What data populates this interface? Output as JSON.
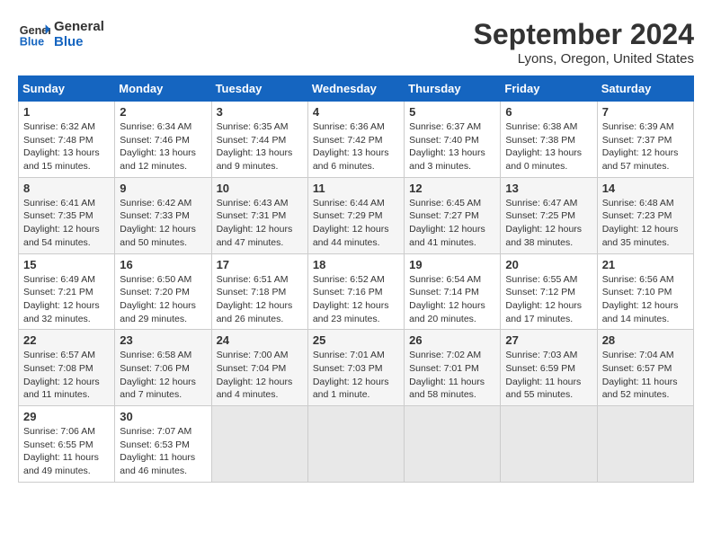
{
  "header": {
    "logo_line1": "General",
    "logo_line2": "Blue",
    "title": "September 2024",
    "subtitle": "Lyons, Oregon, United States"
  },
  "days_of_week": [
    "Sunday",
    "Monday",
    "Tuesday",
    "Wednesday",
    "Thursday",
    "Friday",
    "Saturday"
  ],
  "weeks": [
    [
      {
        "day": "1",
        "sunrise": "6:32 AM",
        "sunset": "7:48 PM",
        "daylight": "13 hours and 15 minutes."
      },
      {
        "day": "2",
        "sunrise": "6:34 AM",
        "sunset": "7:46 PM",
        "daylight": "13 hours and 12 minutes."
      },
      {
        "day": "3",
        "sunrise": "6:35 AM",
        "sunset": "7:44 PM",
        "daylight": "13 hours and 9 minutes."
      },
      {
        "day": "4",
        "sunrise": "6:36 AM",
        "sunset": "7:42 PM",
        "daylight": "13 hours and 6 minutes."
      },
      {
        "day": "5",
        "sunrise": "6:37 AM",
        "sunset": "7:40 PM",
        "daylight": "13 hours and 3 minutes."
      },
      {
        "day": "6",
        "sunrise": "6:38 AM",
        "sunset": "7:38 PM",
        "daylight": "13 hours and 0 minutes."
      },
      {
        "day": "7",
        "sunrise": "6:39 AM",
        "sunset": "7:37 PM",
        "daylight": "12 hours and 57 minutes."
      }
    ],
    [
      {
        "day": "8",
        "sunrise": "6:41 AM",
        "sunset": "7:35 PM",
        "daylight": "12 hours and 54 minutes."
      },
      {
        "day": "9",
        "sunrise": "6:42 AM",
        "sunset": "7:33 PM",
        "daylight": "12 hours and 50 minutes."
      },
      {
        "day": "10",
        "sunrise": "6:43 AM",
        "sunset": "7:31 PM",
        "daylight": "12 hours and 47 minutes."
      },
      {
        "day": "11",
        "sunrise": "6:44 AM",
        "sunset": "7:29 PM",
        "daylight": "12 hours and 44 minutes."
      },
      {
        "day": "12",
        "sunrise": "6:45 AM",
        "sunset": "7:27 PM",
        "daylight": "12 hours and 41 minutes."
      },
      {
        "day": "13",
        "sunrise": "6:47 AM",
        "sunset": "7:25 PM",
        "daylight": "12 hours and 38 minutes."
      },
      {
        "day": "14",
        "sunrise": "6:48 AM",
        "sunset": "7:23 PM",
        "daylight": "12 hours and 35 minutes."
      }
    ],
    [
      {
        "day": "15",
        "sunrise": "6:49 AM",
        "sunset": "7:21 PM",
        "daylight": "12 hours and 32 minutes."
      },
      {
        "day": "16",
        "sunrise": "6:50 AM",
        "sunset": "7:20 PM",
        "daylight": "12 hours and 29 minutes."
      },
      {
        "day": "17",
        "sunrise": "6:51 AM",
        "sunset": "7:18 PM",
        "daylight": "12 hours and 26 minutes."
      },
      {
        "day": "18",
        "sunrise": "6:52 AM",
        "sunset": "7:16 PM",
        "daylight": "12 hours and 23 minutes."
      },
      {
        "day": "19",
        "sunrise": "6:54 AM",
        "sunset": "7:14 PM",
        "daylight": "12 hours and 20 minutes."
      },
      {
        "day": "20",
        "sunrise": "6:55 AM",
        "sunset": "7:12 PM",
        "daylight": "12 hours and 17 minutes."
      },
      {
        "day": "21",
        "sunrise": "6:56 AM",
        "sunset": "7:10 PM",
        "daylight": "12 hours and 14 minutes."
      }
    ],
    [
      {
        "day": "22",
        "sunrise": "6:57 AM",
        "sunset": "7:08 PM",
        "daylight": "12 hours and 11 minutes."
      },
      {
        "day": "23",
        "sunrise": "6:58 AM",
        "sunset": "7:06 PM",
        "daylight": "12 hours and 7 minutes."
      },
      {
        "day": "24",
        "sunrise": "7:00 AM",
        "sunset": "7:04 PM",
        "daylight": "12 hours and 4 minutes."
      },
      {
        "day": "25",
        "sunrise": "7:01 AM",
        "sunset": "7:03 PM",
        "daylight": "12 hours and 1 minute."
      },
      {
        "day": "26",
        "sunrise": "7:02 AM",
        "sunset": "7:01 PM",
        "daylight": "11 hours and 58 minutes."
      },
      {
        "day": "27",
        "sunrise": "7:03 AM",
        "sunset": "6:59 PM",
        "daylight": "11 hours and 55 minutes."
      },
      {
        "day": "28",
        "sunrise": "7:04 AM",
        "sunset": "6:57 PM",
        "daylight": "11 hours and 52 minutes."
      }
    ],
    [
      {
        "day": "29",
        "sunrise": "7:06 AM",
        "sunset": "6:55 PM",
        "daylight": "11 hours and 49 minutes."
      },
      {
        "day": "30",
        "sunrise": "7:07 AM",
        "sunset": "6:53 PM",
        "daylight": "11 hours and 46 minutes."
      },
      null,
      null,
      null,
      null,
      null
    ]
  ]
}
